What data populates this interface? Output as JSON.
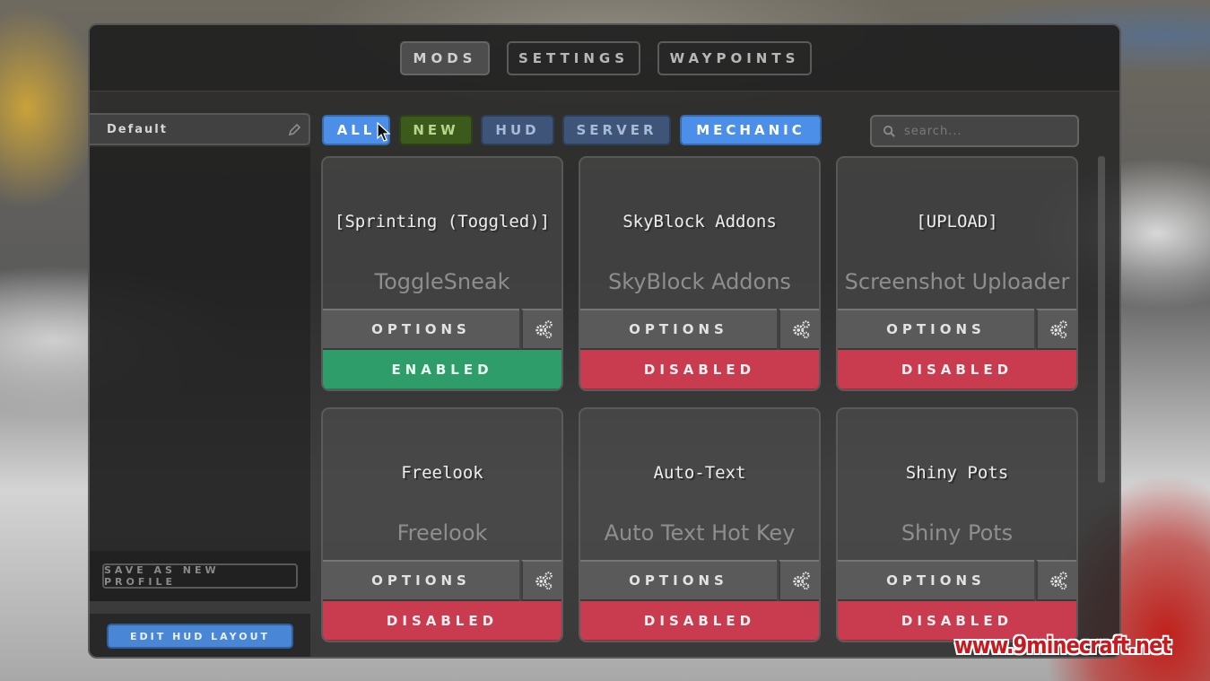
{
  "top_tabs": [
    {
      "label": "MODS",
      "active": true
    },
    {
      "label": "SETTINGS",
      "active": false
    },
    {
      "label": "WAYPOINTS",
      "active": false
    }
  ],
  "sidebar": {
    "profile_name": "Default",
    "save_profile_label": "SAVE AS NEW PROFILE",
    "edit_hud_label": "EDIT HUD LAYOUT"
  },
  "filters": [
    {
      "label": "ALL",
      "selected": true
    },
    {
      "label": "NEW",
      "selected": false
    },
    {
      "label": "HUD",
      "selected": false
    },
    {
      "label": "SERVER",
      "selected": false
    },
    {
      "label": "MECHANIC",
      "selected": true
    }
  ],
  "search": {
    "placeholder": "search..."
  },
  "mods": [
    {
      "title": "[Sprinting (Toggled)]",
      "subtitle": "ToggleSneak",
      "options_label": "OPTIONS",
      "state": "ENABLED"
    },
    {
      "title": "SkyBlock Addons",
      "subtitle": "SkyBlock Addons",
      "options_label": "OPTIONS",
      "state": "DISABLED"
    },
    {
      "title": "[UPLOAD]",
      "subtitle": "Screenshot Uploader",
      "options_label": "OPTIONS",
      "state": "DISABLED"
    },
    {
      "title": "Freelook",
      "subtitle": "Freelook",
      "options_label": "OPTIONS",
      "state": "DISABLED"
    },
    {
      "title": "Auto-Text",
      "subtitle": "Auto Text Hot Key",
      "options_label": "OPTIONS",
      "state": "DISABLED"
    },
    {
      "title": "Shiny Pots",
      "subtitle": "Shiny Pots",
      "options_label": "OPTIONS",
      "state": "DISABLED"
    }
  ],
  "colors": {
    "enabled": "#2f9d6a",
    "disabled": "#c93b4f",
    "accent_blue": "#4b8fe8",
    "new_green": "#3c5a1c"
  },
  "watermark": "www.9minecraft.net"
}
